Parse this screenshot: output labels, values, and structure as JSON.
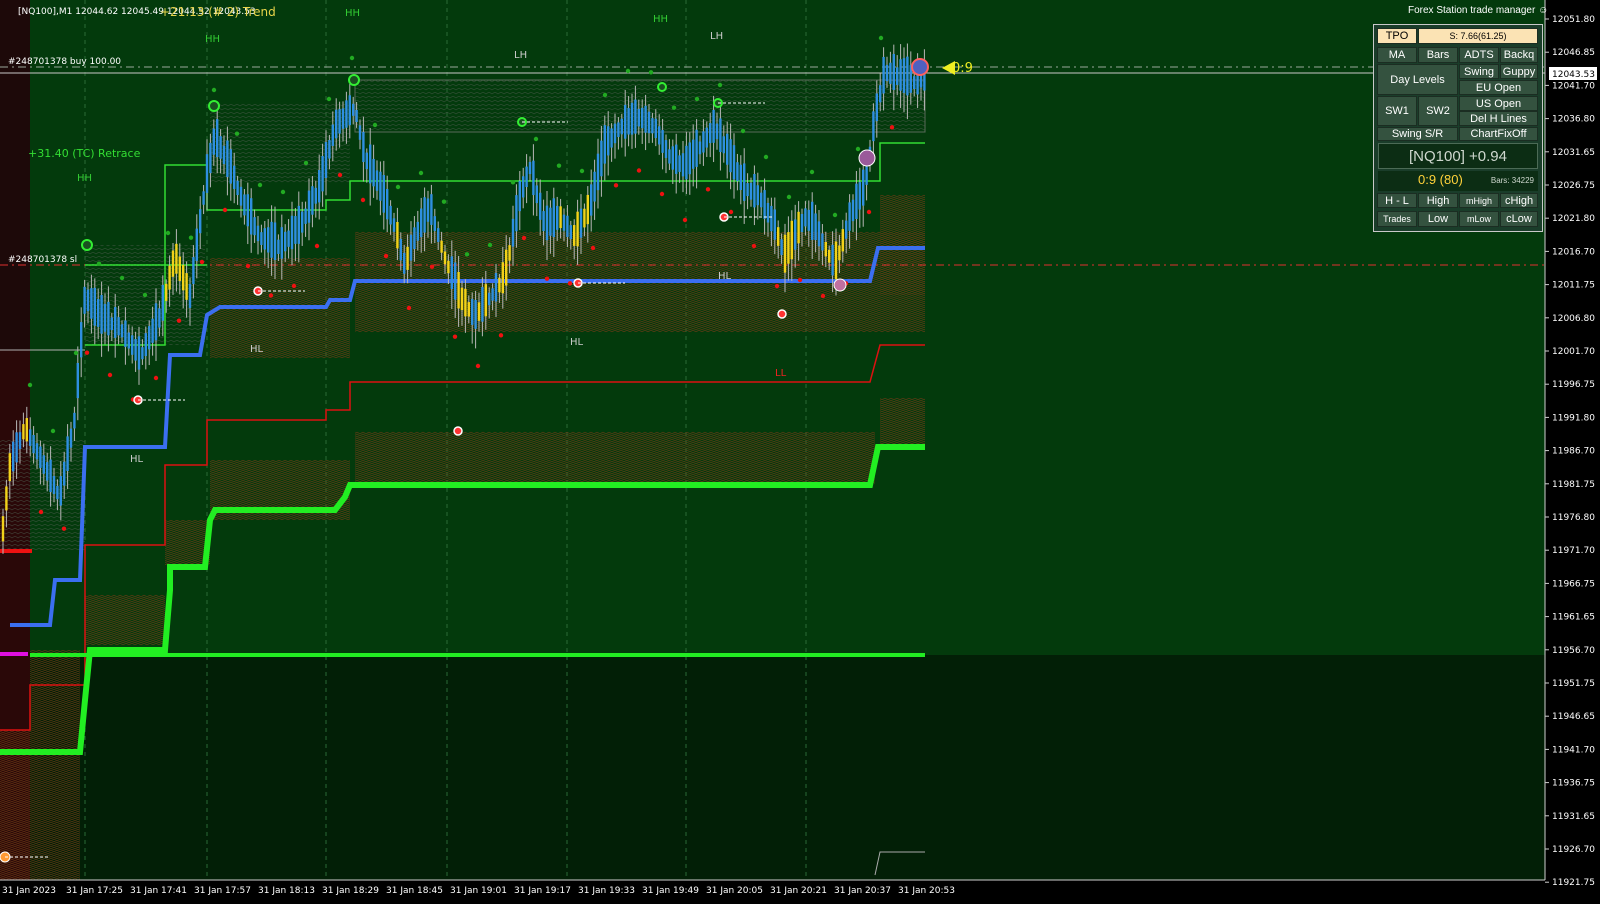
{
  "header": {
    "symbol_info": "[NQ100],M1  12044.62 12045.49 12044.52 12043.53",
    "trend_label": "+21.13 (# 2) Trend",
    "retrace_label": "+31.40 (TC) Retrace"
  },
  "trade_lines": {
    "buy_label": "#248701378 buy 100.00",
    "sl_label": "#248701378 sl",
    "tp_marker": "0:9"
  },
  "swing_labels": {
    "hh": "HH",
    "lh": "LH",
    "hl": "HL",
    "ll": "LL"
  },
  "price_axis": {
    "ticks": [
      "12051.80",
      "12046.85",
      "12041.70",
      "12036.80",
      "12031.65",
      "12026.75",
      "12021.80",
      "12016.70",
      "12011.75",
      "12006.80",
      "12001.70",
      "11996.75",
      "11991.80",
      "11986.70",
      "11981.75",
      "11976.80",
      "11971.70",
      "11966.75",
      "11961.65",
      "11956.70",
      "11951.75",
      "11946.65",
      "11941.70",
      "11936.75",
      "11931.65",
      "11926.70",
      "11921.75"
    ],
    "current_price": "12043.53"
  },
  "time_axis": {
    "ticks": [
      "31 Jan 2023",
      "31 Jan 17:25",
      "31 Jan 17:41",
      "31 Jan 17:57",
      "31 Jan 18:13",
      "31 Jan 18:29",
      "31 Jan 18:45",
      "31 Jan 19:01",
      "31 Jan 19:17",
      "31 Jan 19:33",
      "31 Jan 19:49",
      "31 Jan 20:05",
      "31 Jan 20:21",
      "31 Jan 20:37",
      "31 Jan 20:53"
    ]
  },
  "panel": {
    "title": "Forex Station trade manager",
    "tpo": "TPO",
    "s_value": "S: 7.66(61.25)",
    "ma": "MA",
    "bars": "Bars",
    "adts": "ADTS",
    "backq": "Backq",
    "day_levels": "Day Levels",
    "swing": "Swing",
    "guppy": "Guppy",
    "eu_open": "EU Open",
    "sw1": "SW1",
    "sw2": "SW2",
    "us_open": "US Open",
    "del_h_lines": "Del H Lines",
    "swing_sr": "Swing S/R",
    "chart_fix_off": "ChartFixOff",
    "symbol_change": "[NQ100] +0.94",
    "tp_info": "0:9 (80)",
    "bars_count": "Bars: 34229",
    "h_l": "H - L",
    "high": "High",
    "mhigh": "mHigh",
    "chigh": "cHigh",
    "trades": "Trades",
    "low": "Low",
    "mlow": "mLow",
    "clow": "cLow"
  },
  "colors": {
    "background_top": "#033a0c",
    "background_bottom": "#021f06",
    "up_bar": "#2f8fe0",
    "down_bar": "#f2d21a",
    "blue_line": "#3b6ff0",
    "bright_green": "#22ff22",
    "red_line": "#d01010",
    "axis_bg": "#000000"
  }
}
